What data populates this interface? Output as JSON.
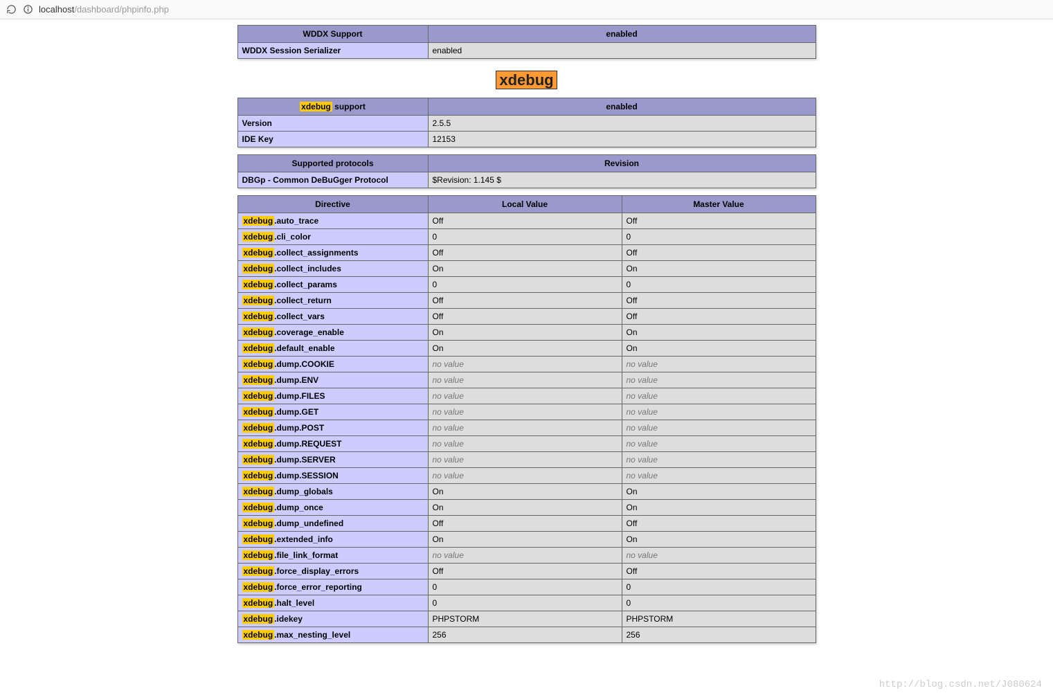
{
  "browser": {
    "url_host": "localhost",
    "url_path": "/dashboard/phpinfo.php"
  },
  "wddx": {
    "header_support": "WDDX Support",
    "header_enabled": "enabled",
    "row1_label": "WDDX Session Serializer",
    "row1_value": "enabled"
  },
  "section_title": "xdebug",
  "support_table": {
    "header_support": " support",
    "header_support_prefix": "xdebug",
    "header_enabled": "enabled",
    "rows": [
      {
        "label": "Version",
        "value": "2.5.5"
      },
      {
        "label": "IDE Key",
        "value": "12153"
      }
    ]
  },
  "protocols_table": {
    "header_left": "Supported protocols",
    "header_right": "Revision",
    "row_label": "DBGp - Common DeBuGger Protocol",
    "row_value": "$Revision: 1.145 $"
  },
  "directives_table": {
    "header_directive": "Directive",
    "header_local": "Local Value",
    "header_master": "Master Value",
    "prefix_hl": "xdebug",
    "rows": [
      {
        "suffix": ".auto_trace",
        "local": "Off",
        "master": "Off"
      },
      {
        "suffix": ".cli_color",
        "local": "0",
        "master": "0"
      },
      {
        "suffix": ".collect_assignments",
        "local": "Off",
        "master": "Off"
      },
      {
        "suffix": ".collect_includes",
        "local": "On",
        "master": "On"
      },
      {
        "suffix": ".collect_params",
        "local": "0",
        "master": "0"
      },
      {
        "suffix": ".collect_return",
        "local": "Off",
        "master": "Off"
      },
      {
        "suffix": ".collect_vars",
        "local": "Off",
        "master": "Off"
      },
      {
        "suffix": ".coverage_enable",
        "local": "On",
        "master": "On"
      },
      {
        "suffix": ".default_enable",
        "local": "On",
        "master": "On"
      },
      {
        "suffix": ".dump.COOKIE",
        "local": "no value",
        "master": "no value",
        "italic": true
      },
      {
        "suffix": ".dump.ENV",
        "local": "no value",
        "master": "no value",
        "italic": true
      },
      {
        "suffix": ".dump.FILES",
        "local": "no value",
        "master": "no value",
        "italic": true
      },
      {
        "suffix": ".dump.GET",
        "local": "no value",
        "master": "no value",
        "italic": true
      },
      {
        "suffix": ".dump.POST",
        "local": "no value",
        "master": "no value",
        "italic": true
      },
      {
        "suffix": ".dump.REQUEST",
        "local": "no value",
        "master": "no value",
        "italic": true
      },
      {
        "suffix": ".dump.SERVER",
        "local": "no value",
        "master": "no value",
        "italic": true
      },
      {
        "suffix": ".dump.SESSION",
        "local": "no value",
        "master": "no value",
        "italic": true
      },
      {
        "suffix": ".dump_globals",
        "local": "On",
        "master": "On"
      },
      {
        "suffix": ".dump_once",
        "local": "On",
        "master": "On"
      },
      {
        "suffix": ".dump_undefined",
        "local": "Off",
        "master": "Off"
      },
      {
        "suffix": ".extended_info",
        "local": "On",
        "master": "On"
      },
      {
        "suffix": ".file_link_format",
        "local": "no value",
        "master": "no value",
        "italic": true
      },
      {
        "suffix": ".force_display_errors",
        "local": "Off",
        "master": "Off"
      },
      {
        "suffix": ".force_error_reporting",
        "local": "0",
        "master": "0"
      },
      {
        "suffix": ".halt_level",
        "local": "0",
        "master": "0"
      },
      {
        "suffix": ".idekey",
        "local": "PHPSTORM",
        "master": "PHPSTORM"
      },
      {
        "suffix": ".max_nesting_level",
        "local": "256",
        "master": "256"
      }
    ]
  },
  "watermark": "http://blog.csdn.net/J080624"
}
